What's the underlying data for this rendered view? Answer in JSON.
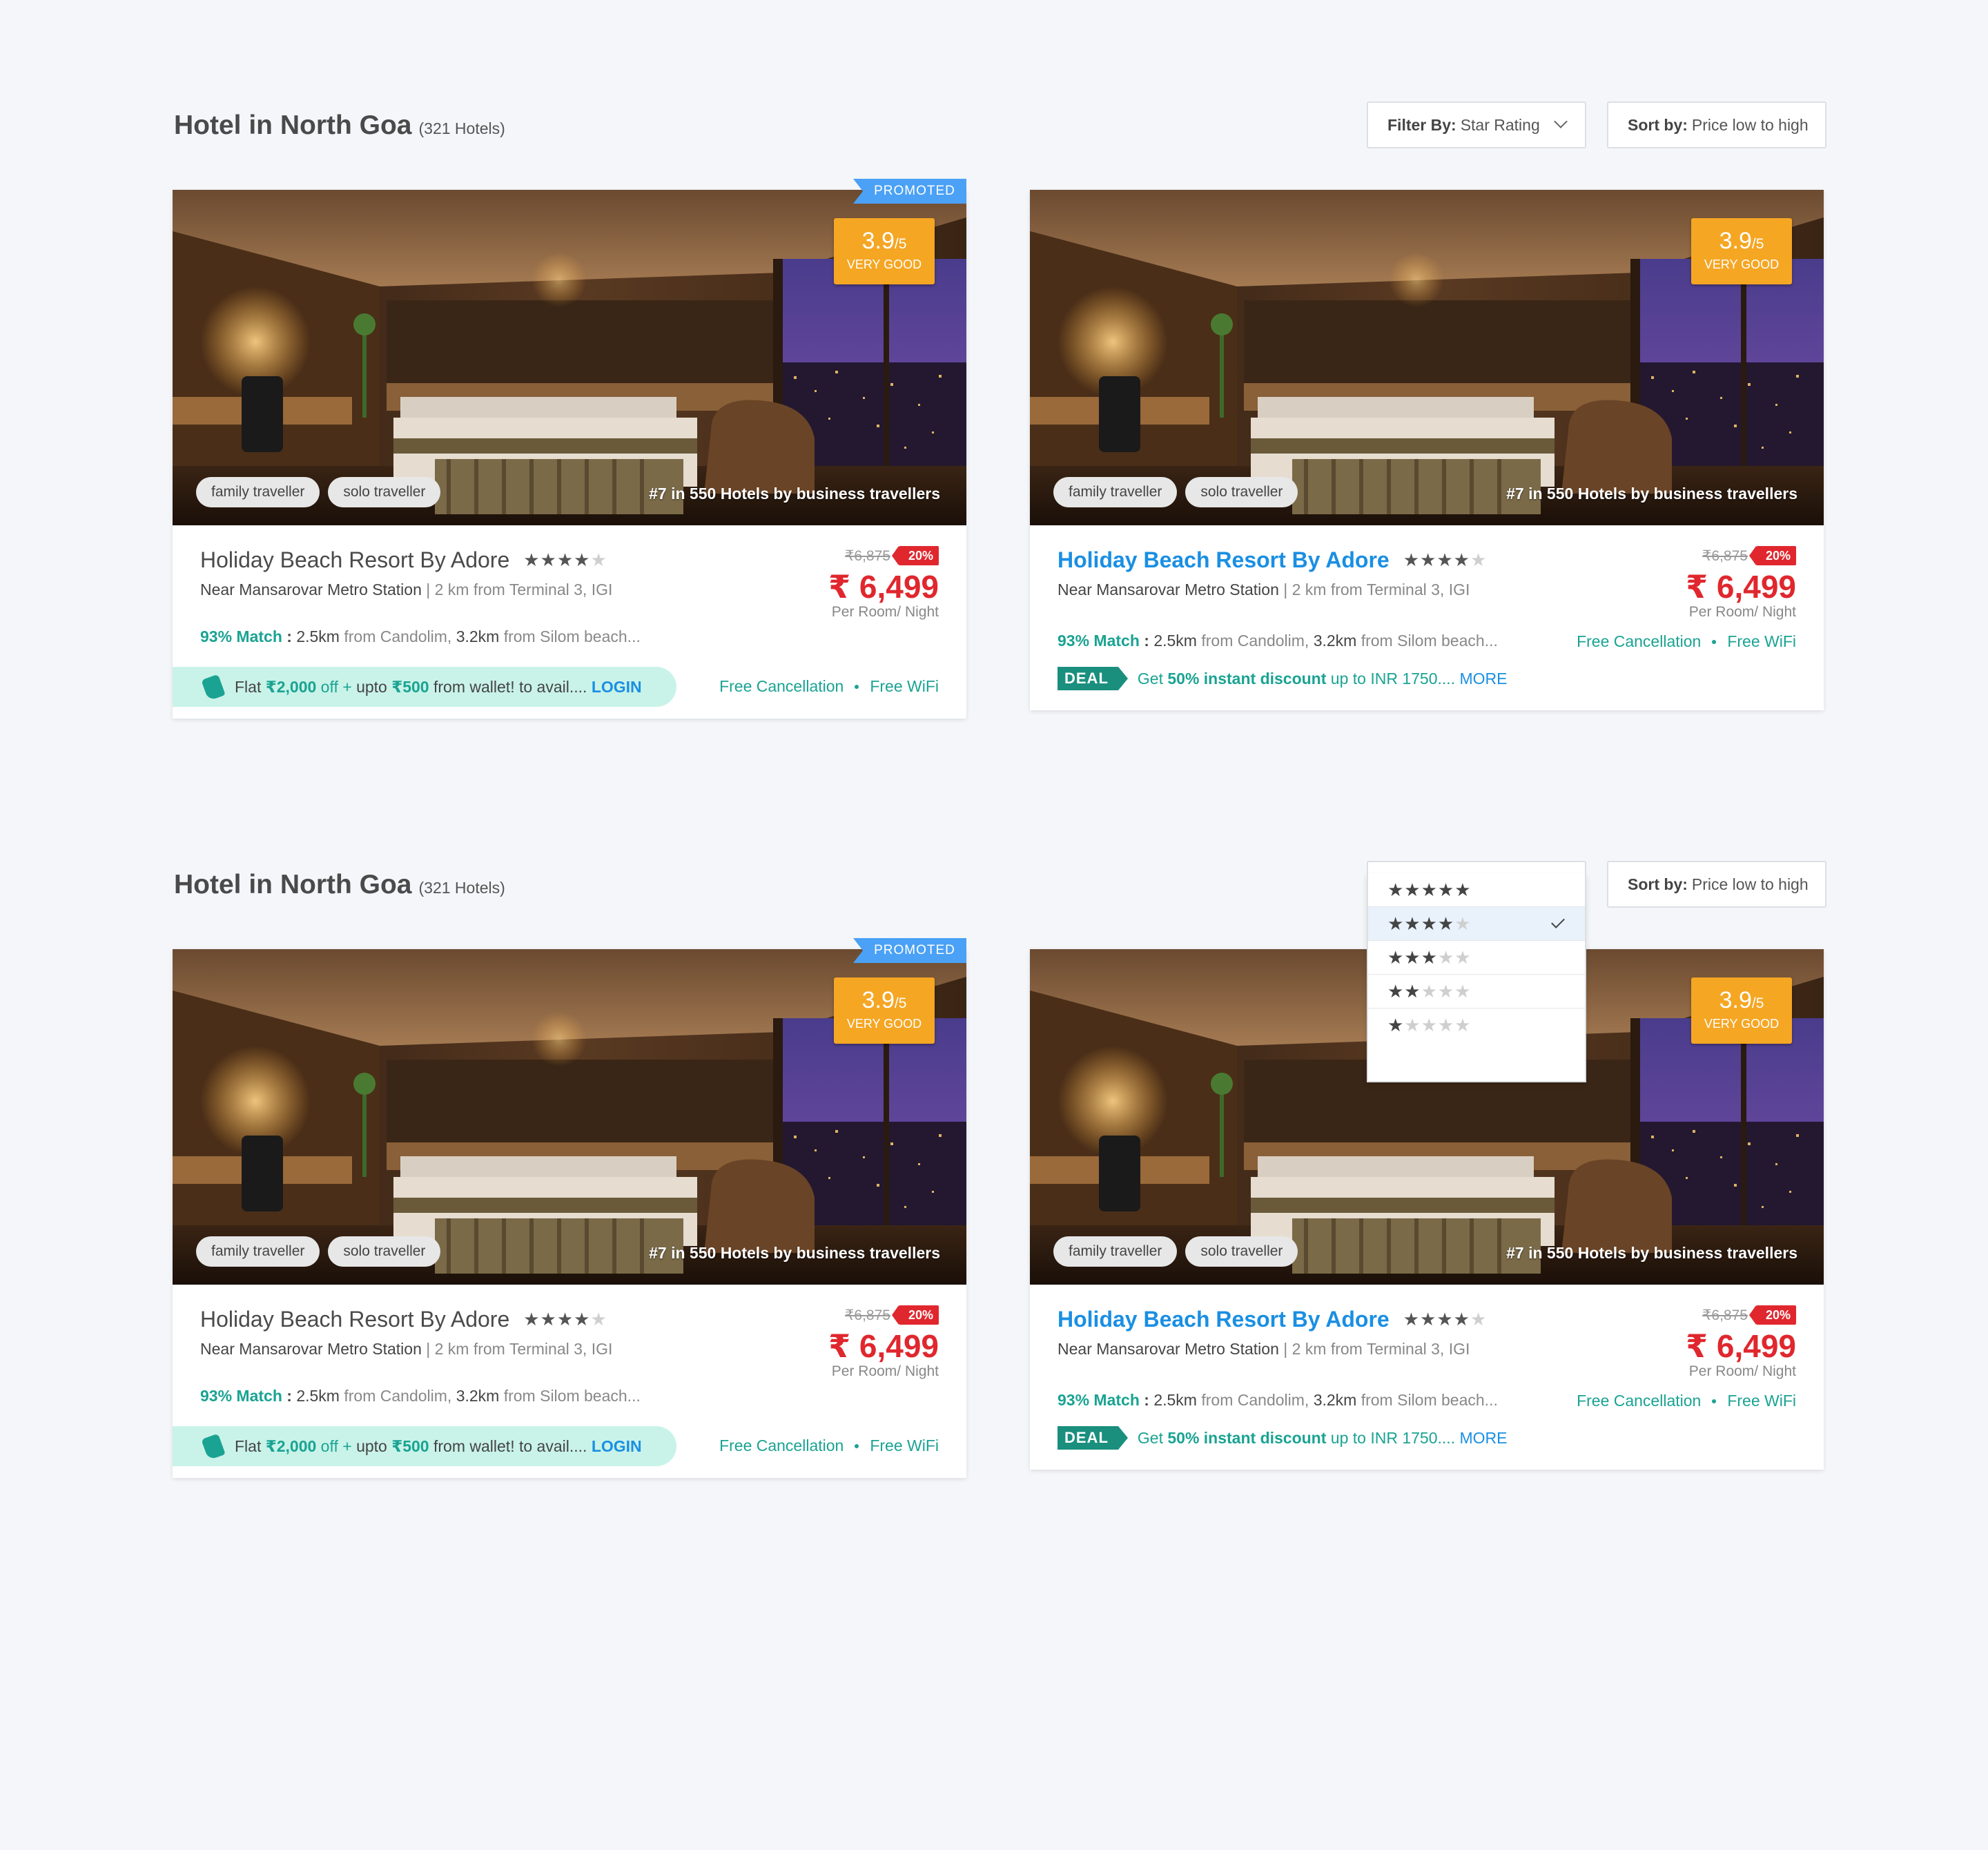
{
  "header": {
    "title": "Hotel in North Goa",
    "count": "(321 Hotels)",
    "filter_label": "Filter By:",
    "filter_value": "Star Rating",
    "sort_label": "Sort by:",
    "sort_value": "Price low to high"
  },
  "card": {
    "promoted": "PROMOTED",
    "rating_score": "3.9",
    "rating_max": "/5",
    "rating_label": "VERY GOOD",
    "tags": [
      "family traveller",
      "solo traveller"
    ],
    "rank": "#7 in 550 Hotels by business travellers",
    "name": "Holiday Beach Resort By Adore",
    "stars_filled": "★★★★",
    "stars_empty": "★",
    "location": "Near Mansarovar Metro Station",
    "distance": "| 2 km from Terminal 3, IGI",
    "match_pct": "93% Match",
    "match_colon": " : ",
    "match_d1": "2.5km",
    "match_p1": " from Candolim, ",
    "match_d2": "3.2km",
    "match_p2": " from Silom beach...",
    "old_price": "₹6,875",
    "discount": "20%",
    "price": "₹ 6,499",
    "per": "Per Room/ Night",
    "offer_1": "Flat ",
    "offer_2": "₹2,000",
    "offer_3": " off + ",
    "offer_4": "upto ",
    "offer_5": "₹500",
    "offer_6": " from wallet! to avail.... ",
    "offer_login": "LOGIN",
    "amenity_1": "Free Cancellation",
    "amenity_2": "Free WiFi",
    "deal_badge": "DEAL",
    "deal_1": "Get ",
    "deal_2": "50% instant discount",
    "deal_3": " up to INR 1750.... ",
    "deal_more": "MORE"
  },
  "star_filter_options": [
    {
      "filled": "★★★★★",
      "empty": ""
    },
    {
      "filled": "★★★★",
      "empty": "★"
    },
    {
      "filled": "★★★",
      "empty": "★★"
    },
    {
      "filled": "★★",
      "empty": "★★★"
    },
    {
      "filled": "★",
      "empty": "★★★★"
    }
  ],
  "colors": {
    "accent_teal": "#1aa393",
    "link_blue": "#1a8fe3",
    "price_red": "#e0272e",
    "rating_orange": "#f5a623",
    "promoted_blue": "#4aa1f5"
  }
}
